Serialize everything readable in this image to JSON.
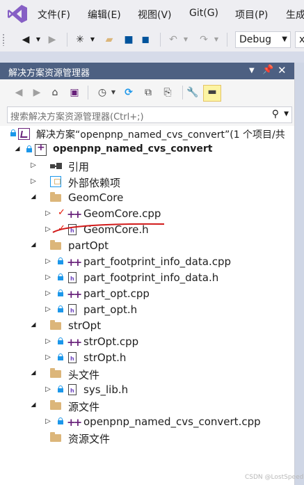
{
  "menubar": {
    "items": [
      "文件(F)",
      "编辑(E)",
      "视图(V)",
      "Git(G)",
      "项目(P)",
      "生成"
    ]
  },
  "toolbar": {
    "config": "Debug",
    "platform_partial": "x"
  },
  "panel": {
    "title": "解决方案资源管理器",
    "search_placeholder": "搜索解决方案资源管理器(Ctrl+;)"
  },
  "tree": {
    "solution": "解决方案“openpnp_named_cvs_convert”(1 个项目/共",
    "project": "openpnp_named_cvs_convert",
    "references": "引用",
    "external_deps": "外部依赖项",
    "geomcore_filter": "GeomCore",
    "geomcore_cpp": "GeomCore.cpp",
    "geomcore_h": "GeomCore.h",
    "partopt_filter": "partOpt",
    "part_footprint_cpp": "part_footprint_info_data.cpp",
    "part_footprint_h": "part_footprint_info_data.h",
    "part_opt_cpp": "part_opt.cpp",
    "part_opt_h": "part_opt.h",
    "stropt_filter": "strOpt",
    "stropt_cpp": "strOpt.cpp",
    "stropt_h": "strOpt.h",
    "header_filter": "头文件",
    "syslib_h": "sys_lib.h",
    "source_filter": "源文件",
    "main_cpp": "openpnp_named_cvs_convert.cpp",
    "resource_filter": "资源文件"
  },
  "colors": {
    "titlebar": "#4d6082",
    "accent": "#68217a",
    "lock": "#1c97ea",
    "annotation": "#d11a1a",
    "modified_check": "#e51400"
  },
  "watermark": "CSDN @LostSpeed"
}
